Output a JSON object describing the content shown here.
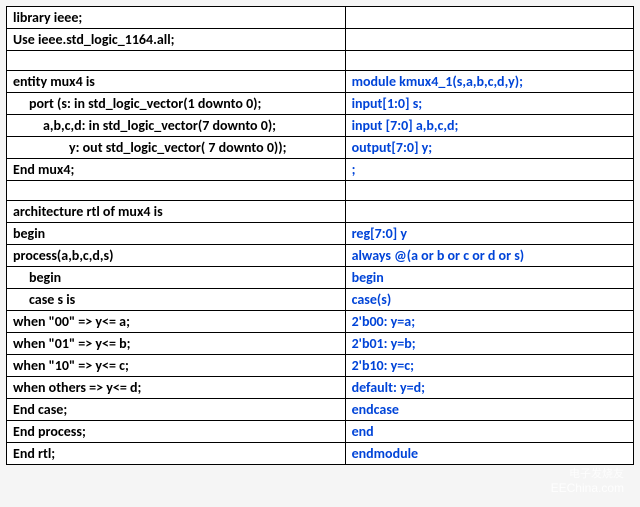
{
  "rows": [
    {
      "left": "library ieee;",
      "right": "",
      "leftClass": "black",
      "rightClass": ""
    },
    {
      "left": "Use ieee.std_logic_1164.all;",
      "right": "",
      "leftClass": "black",
      "rightClass": ""
    },
    {
      "left": "",
      "right": "",
      "leftClass": "",
      "rightClass": ""
    },
    {
      "left": "entity mux4 is",
      "right": "module kmux4_1(s,a,b,c,d,y);",
      "leftClass": "black",
      "rightClass": "blue"
    },
    {
      "left": "port (s: in std_logic_vector(1 downto 0);",
      "right": "input[1:0] s;",
      "leftClass": "black indent1",
      "rightClass": "blue"
    },
    {
      "left": "a,b,c,d: in std_logic_vector(7 downto 0);",
      "right": "input [7:0] a,b,c,d;",
      "leftClass": "black indent2",
      "rightClass": "blue"
    },
    {
      "left": "y: out std_logic_vector( 7 downto 0));",
      "right": "output[7:0] y;",
      "leftClass": "black indent3",
      "rightClass": "blue"
    },
    {
      "left": "End mux4;",
      "right": ";",
      "leftClass": "black",
      "rightClass": "blue"
    },
    {
      "left": "",
      "right": "",
      "leftClass": "",
      "rightClass": ""
    },
    {
      "left": "architecture rtl of mux4 is",
      "right": "",
      "leftClass": "black",
      "rightClass": ""
    },
    {
      "left": "begin",
      "right": "reg[7:0] y",
      "leftClass": "black",
      "rightClass": "blue"
    },
    {
      "left": "process(a,b,c,d,s)",
      "right": "always @(a or b or c or d or s)",
      "leftClass": "black",
      "rightClass": "blue"
    },
    {
      "left": "begin",
      "right": "begin",
      "leftClass": "black indent1",
      "rightClass": "blue"
    },
    {
      "left": "case s is",
      "right": "case(s)",
      "leftClass": "black indent1",
      "rightClass": "blue"
    },
    {
      "left": "when \"00\" => y<= a;",
      "right": "2'b00: y=a;",
      "leftClass": "black",
      "rightClass": "blue"
    },
    {
      "left": "when \"01\" => y<= b;",
      "right": "2'b01: y=b;",
      "leftClass": "black",
      "rightClass": "blue"
    },
    {
      "left": "when \"10\" => y<= c;",
      "right": "2'b10: y=c;",
      "leftClass": "black",
      "rightClass": "blue"
    },
    {
      "left": "when others => y<= d;",
      "right": "default: y=d;",
      "leftClass": "black",
      "rightClass": "blue"
    },
    {
      "left": "End case;",
      "right": "endcase",
      "leftClass": "black",
      "rightClass": "blue"
    },
    {
      "left": "End process;",
      "right": "end",
      "leftClass": "black",
      "rightClass": "blue"
    },
    {
      "left": "End rtl;",
      "right": "endmodule",
      "leftClass": "black",
      "rightClass": "blue"
    }
  ],
  "watermark": {
    "line1": "电子发烧友",
    "line2": "EEChina.com"
  }
}
